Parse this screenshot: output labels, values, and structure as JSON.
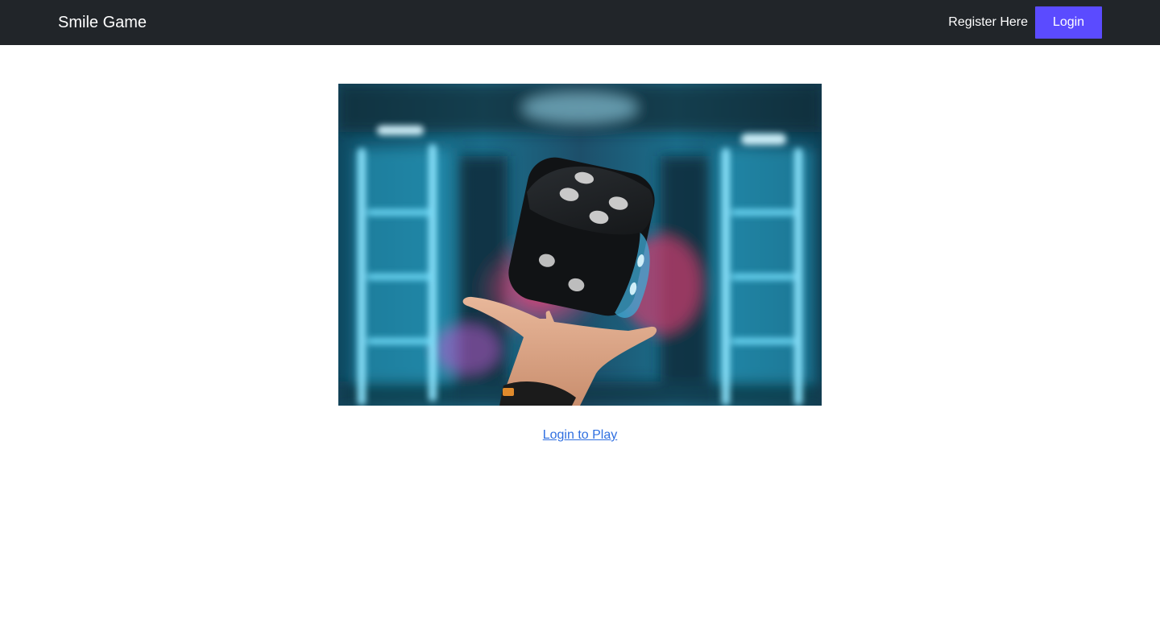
{
  "navbar": {
    "brand": "Smile Game",
    "register_label": "Register Here",
    "login_label": "Login",
    "bg_color": "#212529",
    "login_color": "#5b4bff"
  },
  "main": {
    "hero_image": "dice-on-hand-photo",
    "play_link_label": "Login to Play",
    "link_color": "#2f6fe0"
  }
}
